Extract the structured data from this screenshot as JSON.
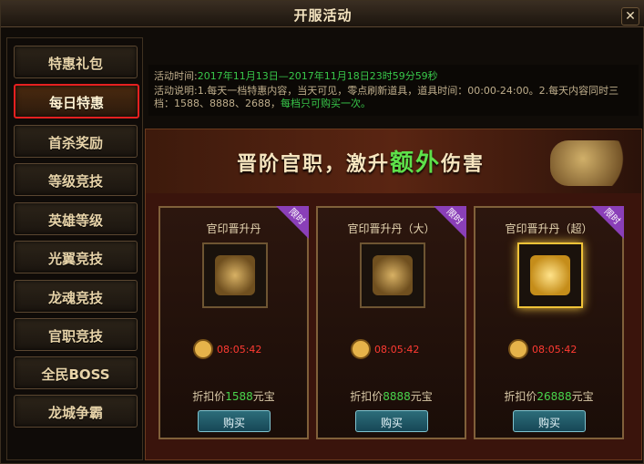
{
  "window": {
    "title": "开服活动",
    "close_label": "✕"
  },
  "sidebar": {
    "items": [
      {
        "label": "特惠礼包"
      },
      {
        "label": "每日特惠",
        "active": true
      },
      {
        "label": "首杀奖励"
      },
      {
        "label": "等级竞技"
      },
      {
        "label": "英雄等级"
      },
      {
        "label": "光翼竞技"
      },
      {
        "label": "龙魂竞技"
      },
      {
        "label": "官职竞技"
      },
      {
        "label": "全民BOSS"
      },
      {
        "label": "龙城争霸"
      }
    ]
  },
  "activity": {
    "time_label": "活动时间:",
    "time_value": "2017年11月13日—2017年11月18日23时59分59秒",
    "desc_label": "活动说明:",
    "desc_text": "1.每天一档特惠内容，当天可见，零点刷新道具，道具时间：00:00-24:00。2.每天内容同时三档：1588、8888、2688，",
    "desc_highlight": "每档只可购买一次。"
  },
  "banner": {
    "part1": "晋阶官职，激升",
    "part2": "额外",
    "part3": "伤害"
  },
  "cards": [
    {
      "name": "官印晋升丹",
      "ribbon": "限时",
      "timer": "08:05:42",
      "price_prefix": "折扣价",
      "price_value": "1588",
      "price_suffix": "元宝",
      "buy_label": "购买"
    },
    {
      "name": "官印晋升丹（大）",
      "ribbon": "限时",
      "timer": "08:05:42",
      "price_prefix": "折扣价",
      "price_value": "8888",
      "price_suffix": "元宝",
      "buy_label": "购买"
    },
    {
      "name": "官印晋升丹（超）",
      "ribbon": "限时",
      "timer": "08:05:42",
      "price_prefix": "折扣价",
      "price_value": "26888",
      "price_suffix": "元宝",
      "buy_label": "购买"
    }
  ],
  "colors": {
    "accent": "#e52020",
    "green": "#38c84a",
    "timer": "#ff3a32"
  }
}
